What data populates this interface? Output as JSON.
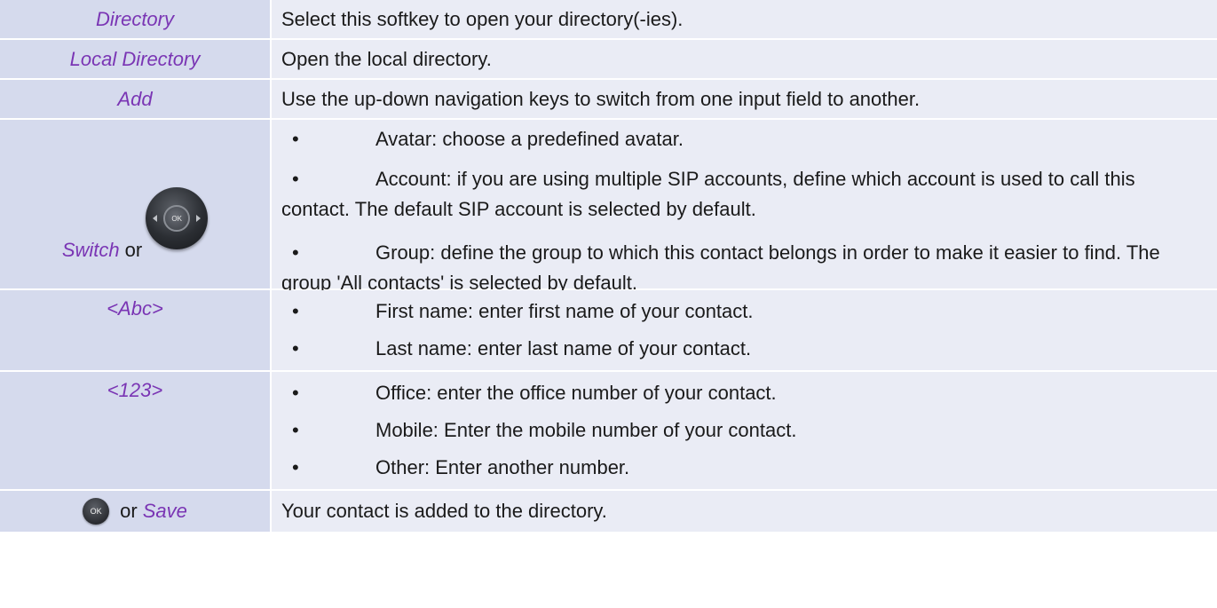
{
  "rows": [
    {
      "key": "Directory",
      "description": "Select this softkey to open your directory(-ies)."
    },
    {
      "key": "Local Directory",
      "description": "Open the local directory."
    },
    {
      "key": "Add",
      "description": "Use the up-down navigation keys to switch from one input field to another."
    },
    {
      "key": "Switch",
      "connector": "or",
      "icon": "navigation-ok-key-icon",
      "icon_label": "OK",
      "bullets": [
        "Avatar: choose a predefined avatar.",
        "Account: if you are using multiple SIP accounts, define which account is used to call this contact. The default SIP account is selected by default.",
        "Group: define the group to which this contact belongs in order to make it easier to find. The group 'All contacts' is selected by default."
      ]
    },
    {
      "key": "<Abc>",
      "bullets": [
        "First name: enter first name of your contact.",
        "Last name: enter last name of your contact."
      ]
    },
    {
      "key": "<123>",
      "bullets": [
        "Office: enter the office number of your contact.",
        "Mobile: Enter the mobile number of your contact.",
        "Other: Enter another number."
      ]
    },
    {
      "icon": "ok-key-icon",
      "icon_label": "OK",
      "connector": "or",
      "key": "Save",
      "description": "Your contact is added to the directory."
    }
  ],
  "bullet_glyph": "•"
}
